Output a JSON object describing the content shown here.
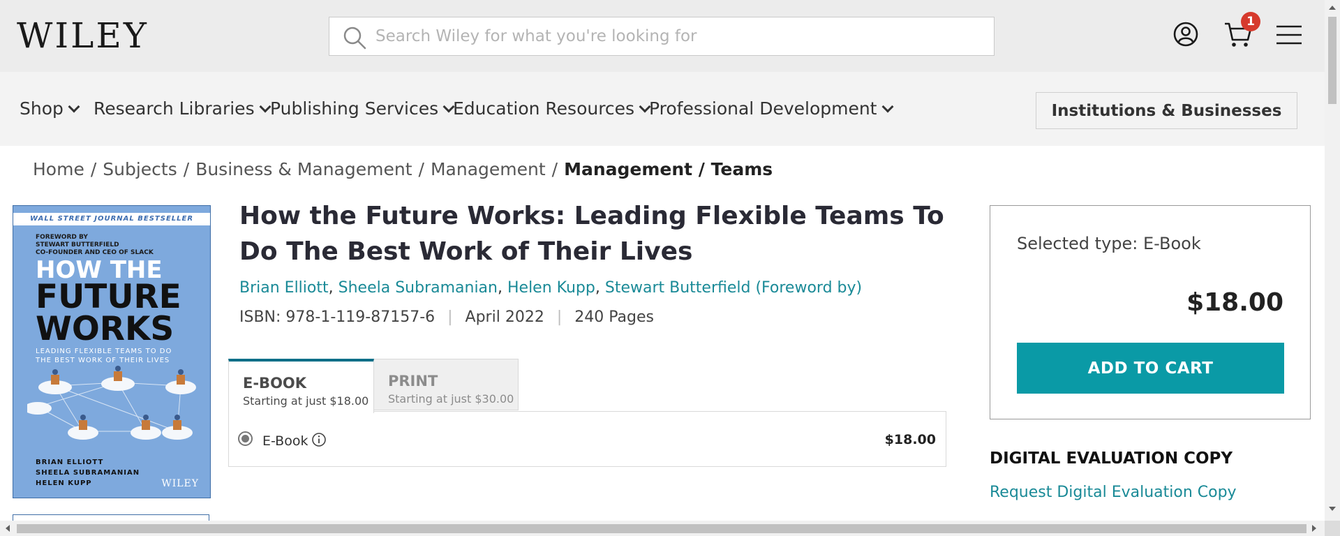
{
  "header": {
    "logo": "WILEY",
    "search_placeholder": "Search Wiley for what you're looking for",
    "cart_count": "1",
    "icons": [
      "search-icon",
      "account-icon",
      "cart-icon",
      "hamburger-menu-icon"
    ]
  },
  "nav": {
    "items": [
      {
        "label": "Shop"
      },
      {
        "label": "Research Libraries"
      },
      {
        "label": "Publishing Services"
      },
      {
        "label": "Education Resources"
      },
      {
        "label": "Professional Development"
      }
    ],
    "institutions_button": "Institutions & Businesses"
  },
  "breadcrumb": {
    "items": [
      "Home",
      "Subjects",
      "Business & Management",
      "Management"
    ],
    "current": "Management / Teams"
  },
  "cover": {
    "banner": "WALL STREET JOURNAL BESTSELLER",
    "foreword_lines": [
      "FOREWORD BY",
      "STEWART BUTTERFIELD",
      "CO-FOUNDER AND CEO OF SLACK"
    ],
    "title_line1": "HOW THE",
    "title_line2": "FUTURE",
    "title_line3": "WORKS",
    "subtitle_line1": "LEADING FLEXIBLE TEAMS TO DO",
    "subtitle_line2": "THE BEST WORK OF THEIR LIVES",
    "authors": [
      "BRIAN ELLIOTT",
      "SHEELA SUBRAMANIAN",
      "HELEN KUPP"
    ],
    "publisher": "WILEY"
  },
  "product": {
    "title": "How the Future Works: Leading Flexible Teams To Do The Best Work of Their Lives",
    "authors": [
      "Brian Elliott",
      "Sheela Subramanian",
      "Helen Kupp",
      "Stewart Butterfield (Foreword by)"
    ],
    "isbn": "ISBN: 978-1-119-87157-6",
    "date": "April 2022",
    "pages": "240 Pages"
  },
  "formats": {
    "tabs": [
      {
        "name": "E-BOOK",
        "sub": "Starting at just $18.00",
        "active": true
      },
      {
        "name": "PRINT",
        "sub": "Starting at just $30.00",
        "active": false
      }
    ],
    "option": {
      "label": "E-Book",
      "price": "$18.00",
      "selected": true
    }
  },
  "buybox": {
    "selected_prefix": "Selected type:",
    "selected_value": "E-Book",
    "price": "$18.00",
    "add_to_cart": "ADD TO CART"
  },
  "evaluation": {
    "heading": "DIGITAL EVALUATION COPY",
    "link": "Request Digital Evaluation Copy"
  },
  "colors": {
    "accent_teal": "#0a9aa6",
    "link_teal": "#1a8a97",
    "badge_red": "#d63a2d",
    "tab_active_border": "#0c6f88"
  }
}
